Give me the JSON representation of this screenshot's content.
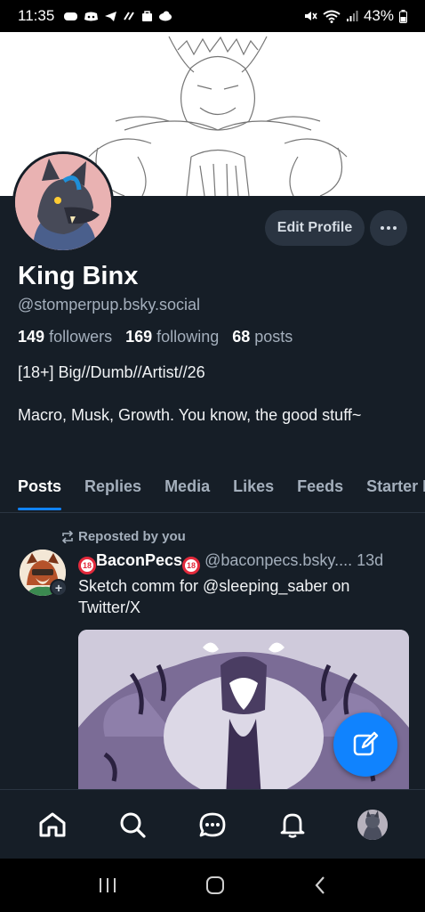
{
  "status_bar": {
    "time": "11:35",
    "battery": "43%",
    "notification_icons": [
      "gamepad-icon",
      "discord-icon",
      "telegram-icon",
      "sync-icon",
      "bag-icon",
      "cloud-icon"
    ],
    "system_icons": [
      "mute-icon",
      "wifi-icon",
      "signal-icon",
      "battery-icon"
    ]
  },
  "profile": {
    "display_name": "King Binx",
    "handle": "@stomperpup.bsky.social",
    "followers_count": "149",
    "followers_label": "followers",
    "following_count": "169",
    "following_label": "following",
    "posts_count": "68",
    "posts_label": "posts",
    "bio_line1": "[18+] Big//Dumb//Artist//26",
    "bio_line2": "Macro, Musk, Growth. You know, the good stuff~",
    "edit_button": "Edit Profile",
    "more_button": "···"
  },
  "tabs": [
    {
      "label": "Posts",
      "active": true
    },
    {
      "label": "Replies",
      "active": false
    },
    {
      "label": "Media",
      "active": false
    },
    {
      "label": "Likes",
      "active": false
    },
    {
      "label": "Feeds",
      "active": false
    },
    {
      "label": "Starter P",
      "active": false
    }
  ],
  "post": {
    "repost_label": "Reposted by you",
    "author": "BaconPecs",
    "author_badge": "18",
    "handle": "@baconpecs.bsky....",
    "time": "13d",
    "text": "Sketch comm for @sleeping_saber on Twitter/X"
  },
  "bottom_nav": [
    "home-icon",
    "search-icon",
    "chat-icon",
    "bell-icon",
    "profile-avatar"
  ],
  "colors": {
    "background": "#161e27",
    "accent": "#1083fe",
    "muted_text": "#a4afbc",
    "button_bg": "#2a3441"
  }
}
